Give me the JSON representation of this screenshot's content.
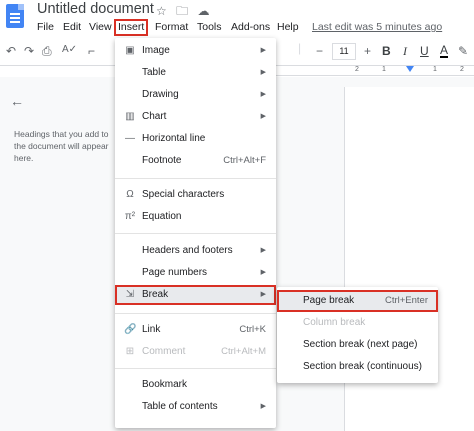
{
  "title_bar": {
    "doc_title": "Untitled document",
    "star_icon": "star-icon",
    "folder_icon": "folder-move-icon",
    "cloud_icon": "cloud-status-icon"
  },
  "menubar": {
    "items": [
      "File",
      "Edit",
      "View",
      "Insert",
      "Format",
      "Tools",
      "Add-ons",
      "Help"
    ],
    "last_edit": "Last edit was 5 minutes ago"
  },
  "toolbar": {
    "undo_icon": "undo-icon",
    "redo_icon": "redo-icon",
    "print_icon": "print-icon",
    "spellcheck_icon": "spellcheck-icon",
    "paint_format_icon": "paint-format-icon",
    "minus": "−",
    "font_size": "11",
    "plus": "+",
    "bold": "B",
    "italic": "I",
    "underline": "U",
    "text_color": "A",
    "highlight_icon": "highlight-icon"
  },
  "ruler": {
    "marks": [
      "2",
      "1",
      "1",
      "2"
    ]
  },
  "outline": {
    "hint": "Headings that you add to the document will appear here."
  },
  "insert_menu": {
    "items": [
      {
        "icon": "▣",
        "label": "Image",
        "arrow": "▶"
      },
      {
        "icon": "",
        "label": "Table",
        "arrow": "▶"
      },
      {
        "icon": "",
        "label": "Drawing",
        "arrow": "▶"
      },
      {
        "icon": "▥",
        "label": "Chart",
        "arrow": "▶"
      },
      {
        "icon": "—",
        "label": "Horizontal line"
      },
      {
        "icon": "",
        "label": "Footnote",
        "shortcut": "Ctrl+Alt+F"
      },
      {
        "icon": "Ω",
        "label": "Special characters"
      },
      {
        "icon": "π²",
        "label": "Equation"
      },
      {
        "icon": "",
        "label": "Headers and footers",
        "arrow": "▶"
      },
      {
        "icon": "",
        "label": "Page numbers",
        "arrow": "▶"
      },
      {
        "icon": "⇲",
        "label": "Break",
        "arrow": "▶"
      },
      {
        "icon": "🔗",
        "label": "Link",
        "shortcut": "Ctrl+K"
      },
      {
        "icon": "⊞",
        "label": "Comment",
        "shortcut": "Ctrl+Alt+M"
      },
      {
        "icon": "",
        "label": "Bookmark"
      },
      {
        "icon": "",
        "label": "Table of contents",
        "arrow": "▶"
      }
    ]
  },
  "break_submenu": {
    "items": [
      {
        "label": "Page break",
        "shortcut": "Ctrl+Enter"
      },
      {
        "label": "Column break"
      },
      {
        "label": "Section break (next page)"
      },
      {
        "label": "Section break (continuous)"
      }
    ]
  },
  "colors": {
    "highlight_border": "#d93025",
    "docs_blue": "#4285f4",
    "hover_bg": "#e8eaed"
  }
}
